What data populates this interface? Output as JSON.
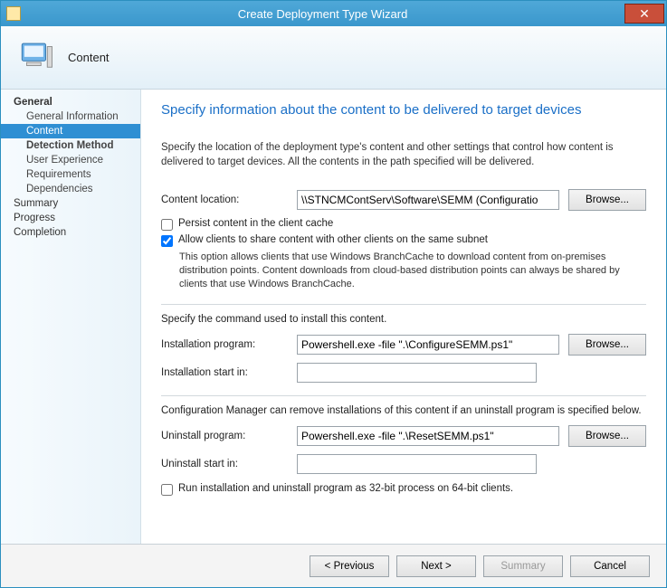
{
  "window": {
    "title": "Create Deployment Type Wizard"
  },
  "header": {
    "page_label": "Content"
  },
  "nav": {
    "general": "General",
    "general_info": "General Information",
    "content": "Content",
    "detection": "Detection Method",
    "user_exp": "User Experience",
    "requirements": "Requirements",
    "dependencies": "Dependencies",
    "summary": "Summary",
    "progress": "Progress",
    "completion": "Completion"
  },
  "main": {
    "heading": "Specify information about the content to be delivered to target devices",
    "desc": "Specify the location of the deployment type's content and other settings that control how content is delivered to target devices. All the contents in the path specified will be delivered.",
    "content_location_lbl": "Content location:",
    "content_location_val": "\\\\STNCMContServ\\Software\\SEMM (Configuratio",
    "browse": "Browse...",
    "persist_lbl": "Persist content in the client cache",
    "persist_checked": false,
    "allow_share_lbl": "Allow clients to share content with other clients on the same subnet",
    "allow_share_checked": true,
    "branchcache_note": "This option allows clients that use Windows BranchCache to download content from on-premises distribution points. Content downloads from cloud-based distribution points can always be shared by clients that use Windows BranchCache.",
    "install_cmd_lbl": "Specify the command used to install this content.",
    "install_prog_lbl": "Installation program:",
    "install_prog_val": "Powershell.exe -file \".\\ConfigureSEMM.ps1\"",
    "install_start_lbl": "Installation start in:",
    "install_start_val": "",
    "uninstall_note": "Configuration Manager can remove installations of this content if an uninstall program is specified below.",
    "uninstall_prog_lbl": "Uninstall program:",
    "uninstall_prog_val": "Powershell.exe -file \".\\ResetSEMM.ps1\"",
    "uninstall_start_lbl": "Uninstall start in:",
    "uninstall_start_val": "",
    "run32_lbl": "Run installation and uninstall program as 32-bit process on 64-bit clients.",
    "run32_checked": false
  },
  "footer": {
    "previous": "< Previous",
    "next": "Next >",
    "summary": "Summary",
    "cancel": "Cancel"
  }
}
